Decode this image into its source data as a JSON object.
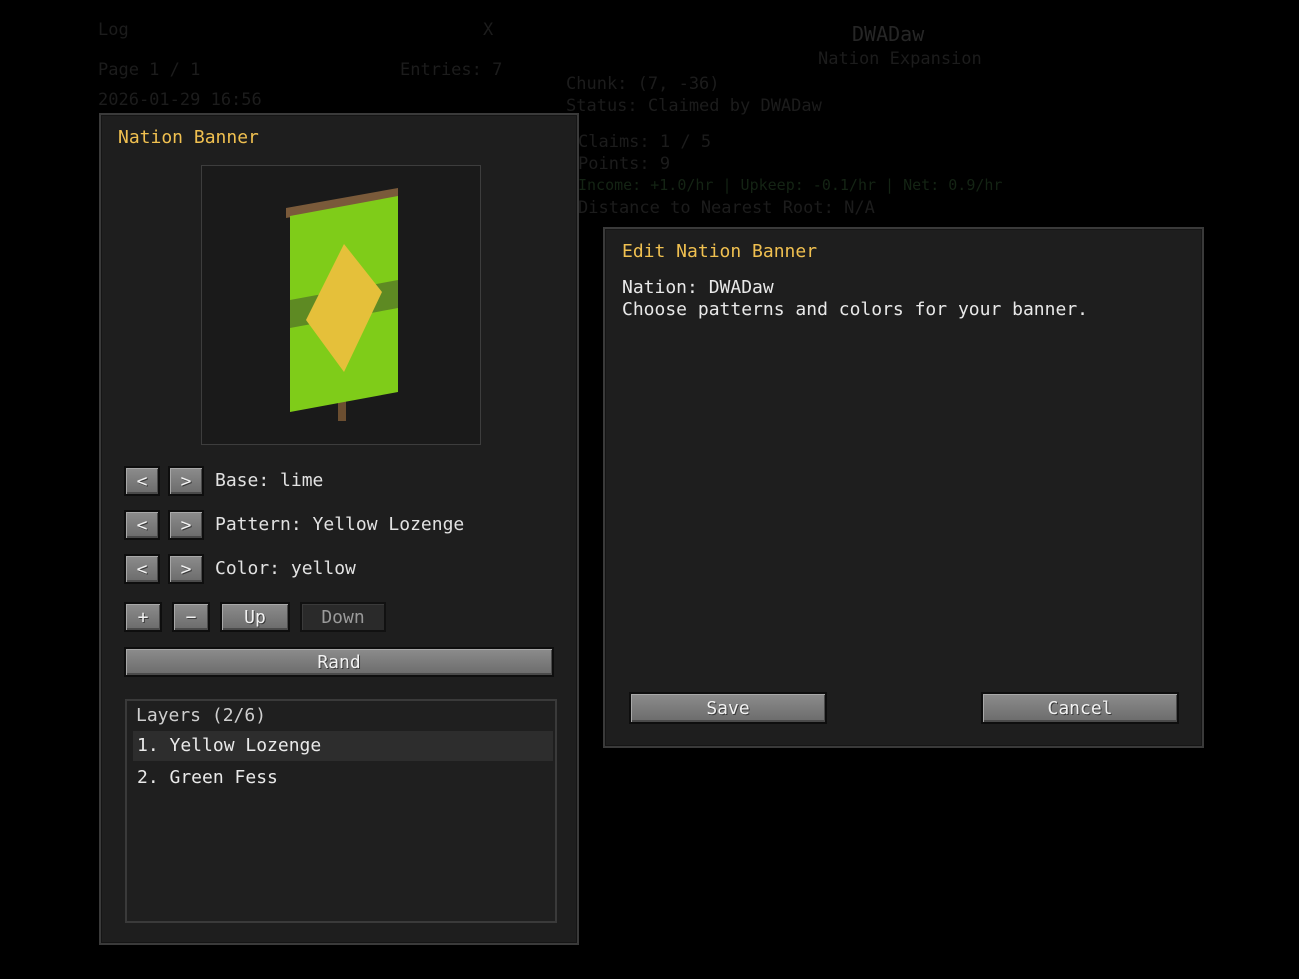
{
  "background": {
    "log_title": "Log",
    "log_x": "X",
    "page": "Page 1 / 1",
    "entries": "Entries: 7",
    "date": "2026-01-29 16:56",
    "nation_name": "DWADaw",
    "nation_sub": "Nation Expansion",
    "chunk": "Chunk: (7, -36)",
    "status": "Status: Claimed by DWADaw",
    "claims": "Claims: 1 / 5",
    "points": "Points: 9",
    "income": "Income: +1.0/hr | Upkeep: -0.1/hr | Net: 0.9/hr",
    "distance": "Distance to Nearest Root: N/A"
  },
  "banner_panel": {
    "title": "Nation Banner",
    "base_label": "Base: lime",
    "pattern_label": "Pattern: Yellow Lozenge",
    "color_label": "Color: yellow",
    "prev_glyph": "<",
    "next_glyph": ">",
    "add_label": "+",
    "remove_label": "−",
    "up_label": "Up",
    "down_label": "Down",
    "rand_label": "Rand",
    "layers_header": "Layers (2/6)",
    "layers": [
      "1. Yellow Lozenge",
      "2. Green Fess"
    ],
    "colors": {
      "base": "#7fcc19",
      "lozenge": "#e5c03a",
      "fess": "#5e8a23",
      "pole": "#7a5a3a"
    }
  },
  "edit_dialog": {
    "title": "Edit Nation Banner",
    "nation_line": "Nation: DWADaw",
    "instruction": "Choose patterns and colors for your banner.",
    "save_label": "Save",
    "cancel_label": "Cancel"
  },
  "colors": {
    "accent": "#f0c050",
    "panel": "#1e1e1e"
  }
}
